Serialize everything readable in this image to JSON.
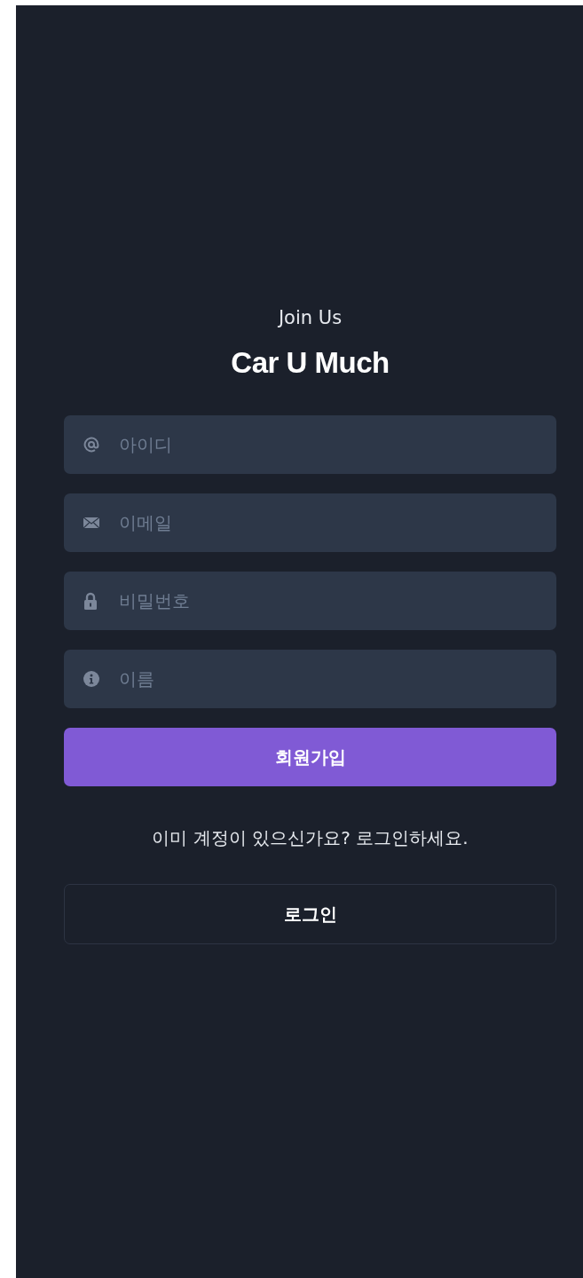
{
  "subtitle": "Join Us",
  "title": "Car U Much",
  "fields": [
    {
      "kind": "at",
      "placeholder": "아이디"
    },
    {
      "kind": "mail",
      "placeholder": "이메일"
    },
    {
      "kind": "lock",
      "placeholder": "비밀번호"
    },
    {
      "kind": "info",
      "placeholder": "이름"
    }
  ],
  "signup_button": "회원가입",
  "login_prompt": "이미 계정이 있으신가요? 로그인하세요.",
  "login_button": "로그인"
}
